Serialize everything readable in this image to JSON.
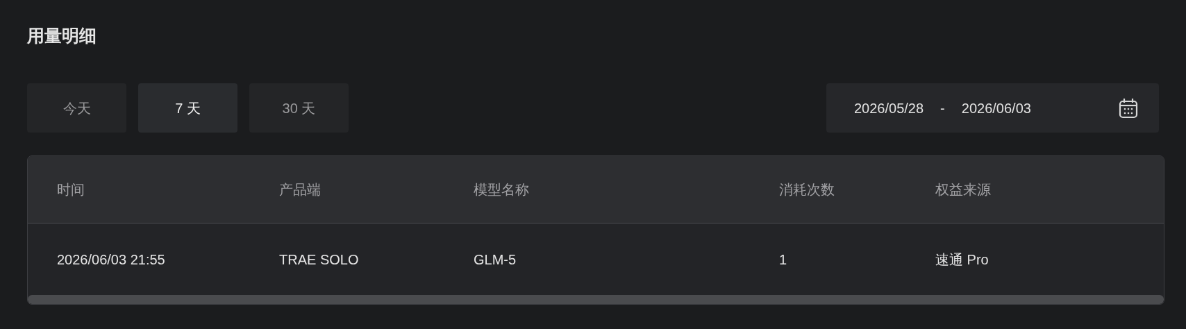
{
  "title": "用量明细",
  "range_tabs": [
    {
      "label": "今天",
      "selected": false
    },
    {
      "label": "7 天",
      "selected": true
    },
    {
      "label": "30 天",
      "selected": false
    }
  ],
  "date_range": {
    "start": "2026/05/28",
    "separator": "-",
    "end": "2026/06/03"
  },
  "table": {
    "columns": [
      "时间",
      "产品端",
      "模型名称",
      "消耗次数",
      "权益来源"
    ],
    "rows": [
      [
        "2026/06/03 21:55",
        "TRAE SOLO",
        "GLM-5",
        "1",
        "速通 Pro"
      ]
    ]
  }
}
